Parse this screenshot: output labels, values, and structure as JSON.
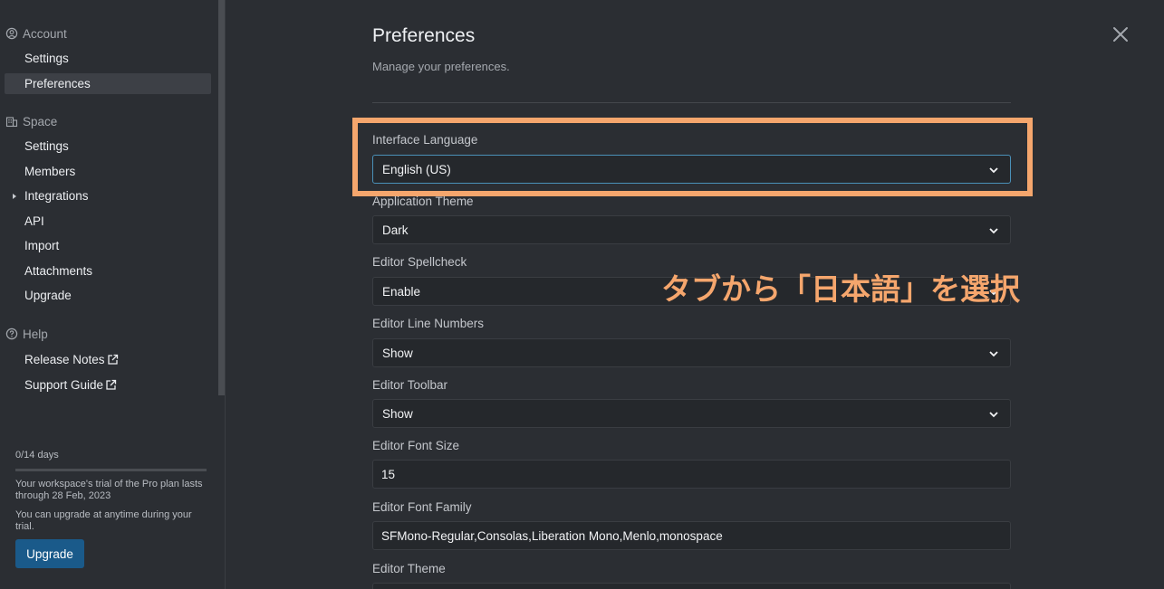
{
  "sidebar": {
    "account": {
      "heading": "Account",
      "items": [
        {
          "label": "Settings",
          "active": false
        },
        {
          "label": "Preferences",
          "active": true
        }
      ]
    },
    "space": {
      "heading": "Space",
      "items": [
        {
          "label": "Settings"
        },
        {
          "label": "Members"
        },
        {
          "label": "Integrations",
          "expandable": true
        },
        {
          "label": "API"
        },
        {
          "label": "Import"
        },
        {
          "label": "Attachments"
        },
        {
          "label": "Upgrade"
        }
      ]
    },
    "help": {
      "heading": "Help",
      "items": [
        {
          "label": "Release Notes",
          "external": true
        },
        {
          "label": "Support Guide",
          "external": true
        }
      ]
    },
    "trial": {
      "days": "0/14 days",
      "message1": "Your workspace's trial of the Pro plan lasts through 28 Feb, 2023",
      "message2": "You can upgrade at anytime during your trial.",
      "button": "Upgrade"
    }
  },
  "main": {
    "title": "Preferences",
    "subtitle": "Manage your preferences.",
    "fields": [
      {
        "label": "Interface Language",
        "value": "English (US)",
        "type": "select"
      },
      {
        "label": "Application Theme",
        "value": "Dark",
        "type": "select"
      },
      {
        "label": "Editor Spellcheck",
        "value": "Enable",
        "type": "select"
      },
      {
        "label": "Editor Line Numbers",
        "value": "Show",
        "type": "select"
      },
      {
        "label": "Editor Toolbar",
        "value": "Show",
        "type": "select"
      },
      {
        "label": "Editor Font Size",
        "value": "15",
        "type": "input"
      },
      {
        "label": "Editor Font Family",
        "value": "SFMono-Regular,Consolas,Liberation Mono,Menlo,monospace",
        "type": "input"
      },
      {
        "label": "Editor Theme",
        "value": "",
        "type": "select"
      }
    ]
  },
  "annotation": {
    "text": "タブから「日本語」を選択",
    "color": "#f5a66d"
  },
  "colors": {
    "background": "#2b2e33",
    "accent": "#1a5a8a",
    "highlight": "#f5a66d"
  }
}
